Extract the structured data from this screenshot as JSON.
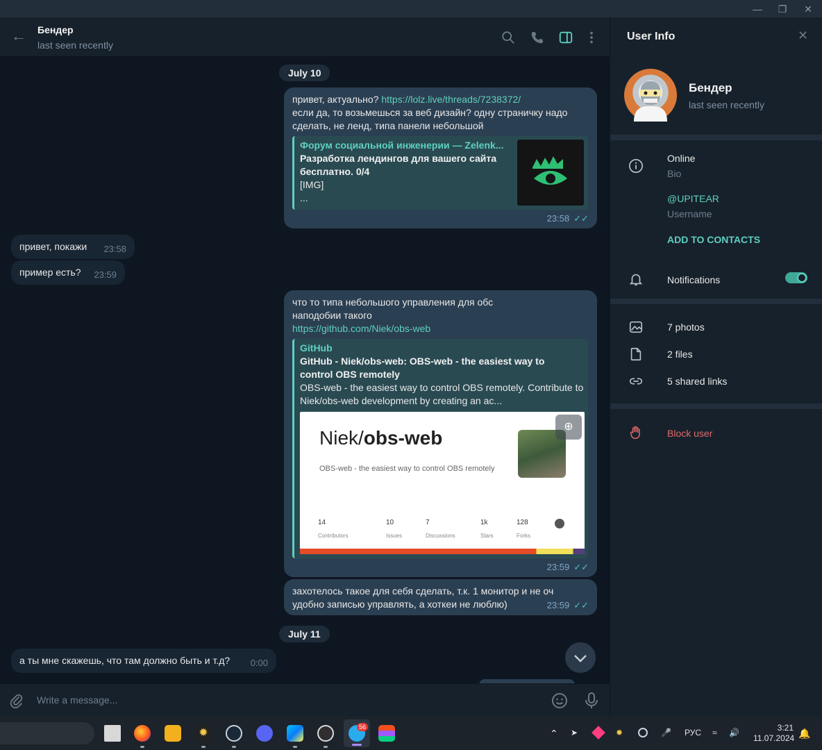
{
  "header": {
    "name": "Бендер",
    "status": "last seen recently"
  },
  "dates": {
    "first": "July 10",
    "second": "July 11"
  },
  "messages": {
    "m1": {
      "text_before": "привет, актуально? ",
      "link": "https://lolz.live/threads/7238372/",
      "text_after": "если да, то возьмешься за веб дизайн? одну страничку надо сделать, не ленд, типа панели небольшой",
      "preview": {
        "site": "Форум социальной инженерии — Zelenk...",
        "title": "Разработка лендингов для вашего сайта бесплатно. 0/4",
        "line3": "[IMG]",
        "line4": "..."
      },
      "time": "23:58"
    },
    "m2": {
      "text": "привет, покажи",
      "time": "23:58"
    },
    "m3": {
      "text": "пример есть?",
      "time": "23:59"
    },
    "m4": {
      "line1": "что то типа небольшого управления для обс",
      "line2": "наподобии такого",
      "link": "https://github.com/Niek/obs-web",
      "preview": {
        "site": "GitHub",
        "title": "GitHub - Niek/obs-web: OBS-web - the easiest way to control OBS remotely",
        "desc": "OBS-web - the easiest way to control OBS remotely. Contribute to Niek/obs-web development by creating an ac...",
        "card": {
          "owner": "Niek/",
          "repo": "obs-web",
          "subtitle": "OBS-web - the easiest way to control OBS remotely",
          "stats": [
            {
              "value": "14",
              "label": "Contributors"
            },
            {
              "value": "10",
              "label": "Issues"
            },
            {
              "value": "7",
              "label": "Discussions"
            },
            {
              "value": "1k",
              "label": "Stars"
            },
            {
              "value": "128",
              "label": "Forks"
            }
          ]
        }
      },
      "time": "23:59"
    },
    "m5": {
      "text": "захотелось такое для себя сделать, т.к. 1 монитор и не оч удобно записью управлять, а хоткеи не люблю)",
      "time": "23:59"
    },
    "m6": {
      "text": "а ты мне скажешь, что там должно быть и т.д?",
      "time": "0:00"
    }
  },
  "composer": {
    "placeholder": "Write a message..."
  },
  "panel": {
    "title": "User Info",
    "name": "Бендер",
    "status": "last seen recently",
    "bio_value": "Online",
    "bio_label": "Bio",
    "username_value": "@UPITEAR",
    "username_label": "Username",
    "add_contacts": "ADD TO CONTACTS",
    "notifications": "Notifications",
    "notifications_on": true,
    "photos": "7 photos",
    "files": "2 files",
    "links": "5 shared links",
    "block": "Block user"
  },
  "taskbar": {
    "lang": "РУС",
    "time": "3:21",
    "date": "11.07.2024",
    "telegram_badge": "56"
  },
  "colors": {
    "accent": "#5fd0c0",
    "danger": "#e06c6c",
    "bg": "#0e1621",
    "panel": "#17212b"
  }
}
